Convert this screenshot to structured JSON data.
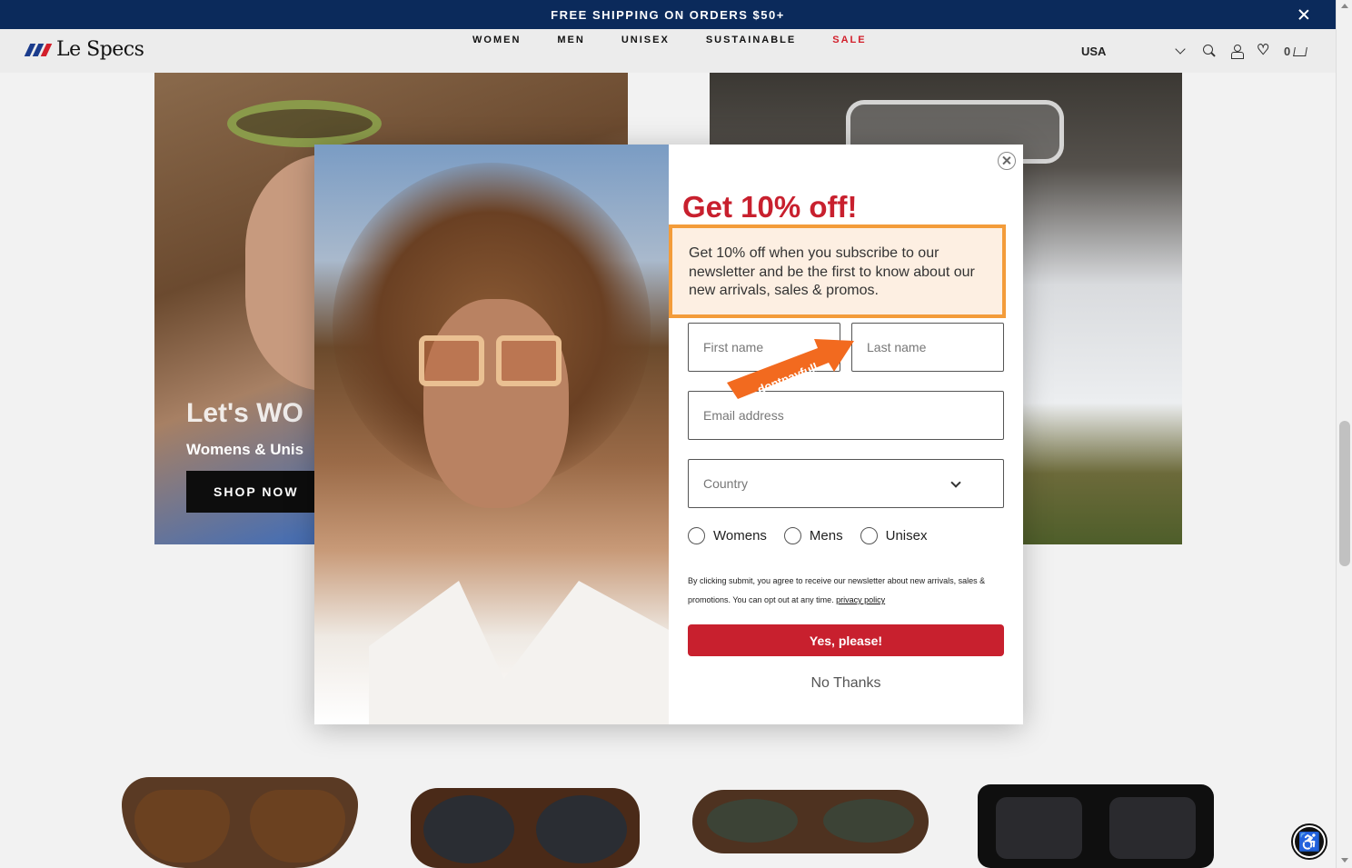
{
  "banner": {
    "text": "FREE SHIPPING ON ORDERS $50+",
    "close_icon": "close-icon"
  },
  "header": {
    "logo_text": "Le Specs",
    "logo_colors": [
      "#1b3c8c",
      "#1b3c8c",
      "#d21f2b"
    ],
    "nav": [
      {
        "label": "WOMEN"
      },
      {
        "label": "MEN"
      },
      {
        "label": "UNISEX"
      },
      {
        "label": "SUSTAINABLE"
      },
      {
        "label": "SALE"
      }
    ],
    "country": "USA",
    "cart_count": "0",
    "icons": [
      "search-icon",
      "user-icon",
      "heart-icon",
      "cart-icon"
    ]
  },
  "hero_left": {
    "title": "Let's WO",
    "subtitle": "Womens & Unis",
    "button": "SHOP NOW"
  },
  "modal": {
    "title": "Get 10% off!",
    "description": "Get 10% off when you subscribe to our newsletter and be the first to know about our new arrivals, sales & promos.",
    "first_name_placeholder": "First name",
    "last_name_placeholder": "Last name",
    "email_placeholder": "Email address",
    "country_placeholder": "Country",
    "radio_options": [
      "Womens",
      "Mens",
      "Unisex"
    ],
    "legal_text": "By clicking submit, you agree to receive our newsletter about new arrivals, sales & promotions. You can opt out at any time. ",
    "privacy_link": "privacy policy",
    "submit_label": "Yes, please!",
    "decline_label": "No Thanks",
    "accent_color": "#c8202e"
  },
  "watermark": {
    "arrow_text": "dontpayfull"
  },
  "accessibility_icon": "accessibility-icon"
}
